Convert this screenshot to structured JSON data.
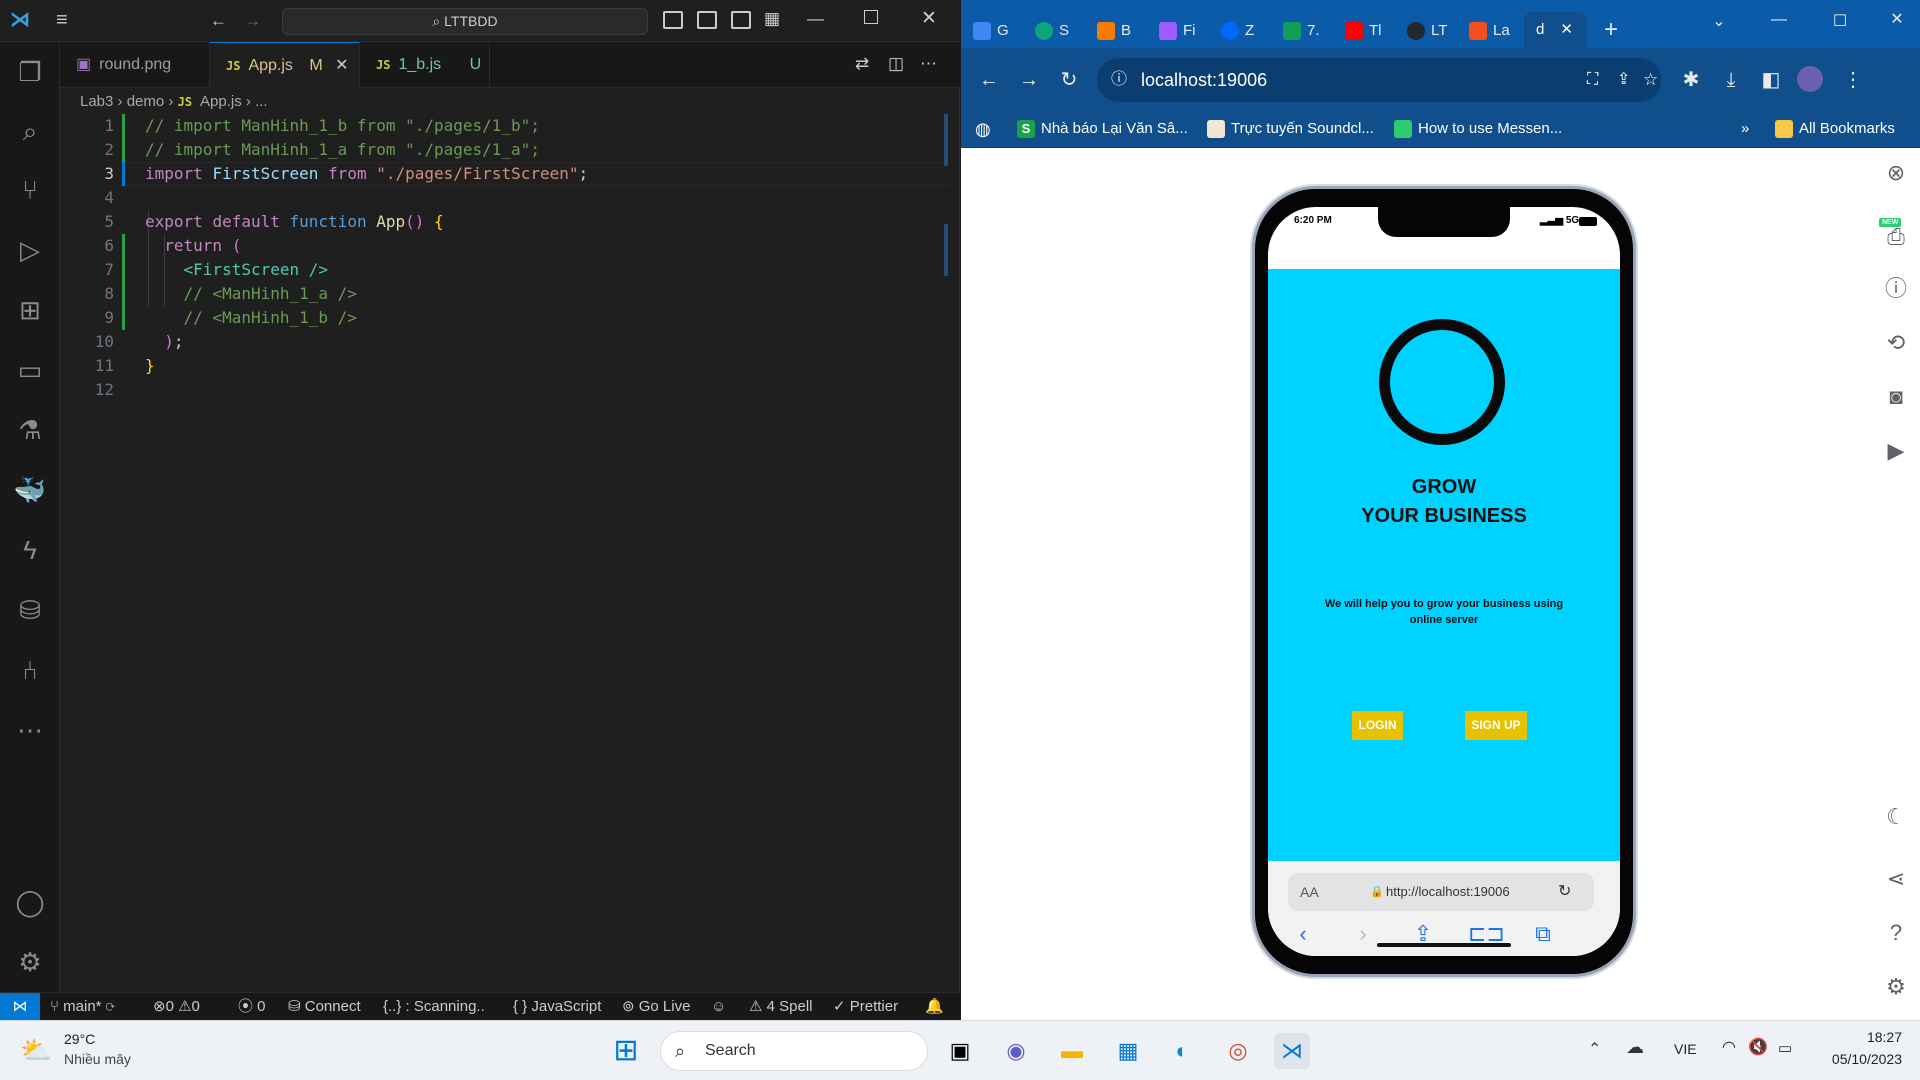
{
  "vscode": {
    "search_text": "LTTBDD",
    "tabs": [
      {
        "label": "round.png",
        "badge": ""
      },
      {
        "label": "App.js",
        "badge": "M"
      },
      {
        "label": "1_b.js",
        "badge": "U"
      }
    ],
    "breadcrumb": [
      "Lab3",
      "demo",
      "App.js",
      "..."
    ],
    "line_numbers": [
      "1",
      "2",
      "3",
      "4",
      "5",
      "6",
      "7",
      "8",
      "9",
      "10",
      "11",
      "12"
    ],
    "code": {
      "l1": "// import ManHinh_1_b from \"./pages/1_b\";",
      "l2": "// import ManHinh_1_a from \"./pages/1_a\";",
      "l3_import": "import",
      "l3_name": "FirstScreen",
      "l3_from": "from",
      "l3_path": "\"./pages/FirstScreen\"",
      "l3_semi": ";",
      "l5_export": "export",
      "l5_default": "default",
      "l5_function": "function",
      "l5_name": "App",
      "l5_parens": "()",
      "l5_brace": "{",
      "l6_return": "return",
      "l6_paren": "(",
      "l7": "<FirstScreen />",
      "l8": "// <ManHinh_1_a />",
      "l9": "// <ManHinh_1_b />",
      "l10_paren": ")",
      "l10_semi": ";",
      "l11": "}"
    },
    "status": {
      "branch": "main*",
      "errors": "0",
      "warnings": "0",
      "ports": "0",
      "connect": "Connect",
      "scanning": "{..} : Scanning..",
      "language": "{ } JavaScript",
      "golive": "Go Live",
      "spell": "4 Spell",
      "prettier": "Prettier"
    }
  },
  "chrome": {
    "tabs": [
      {
        "label": "G",
        "color": "#4285f4"
      },
      {
        "label": "S",
        "color": "#10a37f"
      },
      {
        "label": "B",
        "color": "#f57c00"
      },
      {
        "label": "Fi",
        "color": "#a259ff"
      },
      {
        "label": "Z",
        "color": "#0068ff"
      },
      {
        "label": "7.",
        "color": "#0f9d58"
      },
      {
        "label": "Tl",
        "color": "#ff0000"
      },
      {
        "label": "LT",
        "color": "#24292f"
      },
      {
        "label": "La",
        "color": "#f24e1e"
      }
    ],
    "active_tab": "d",
    "url": "localhost:19006",
    "bookmarks": [
      "Nhà báo Lại Văn Sâ...",
      "Trực tuyến Soundcl...",
      "How to use Messen..."
    ],
    "all_bookmarks": "All Bookmarks",
    "new_badge": "NEW"
  },
  "phone": {
    "time": "6:20 PM",
    "network": "5G",
    "headline_1": "GROW",
    "headline_2": "YOUR BUSINESS",
    "subtitle": "We will help you to grow your business using online server",
    "login": "LOGIN",
    "signup": "SIGN UP",
    "text_size": "AA",
    "url": "http://localhost:19006",
    "bg_color": "#00d2ff",
    "button_color": "#e6c200"
  },
  "taskbar": {
    "weather_temp": "29°C",
    "weather_desc": "Nhiều mây",
    "search": "Search",
    "language": "VIE",
    "time": "18:27",
    "date": "05/10/2023"
  }
}
